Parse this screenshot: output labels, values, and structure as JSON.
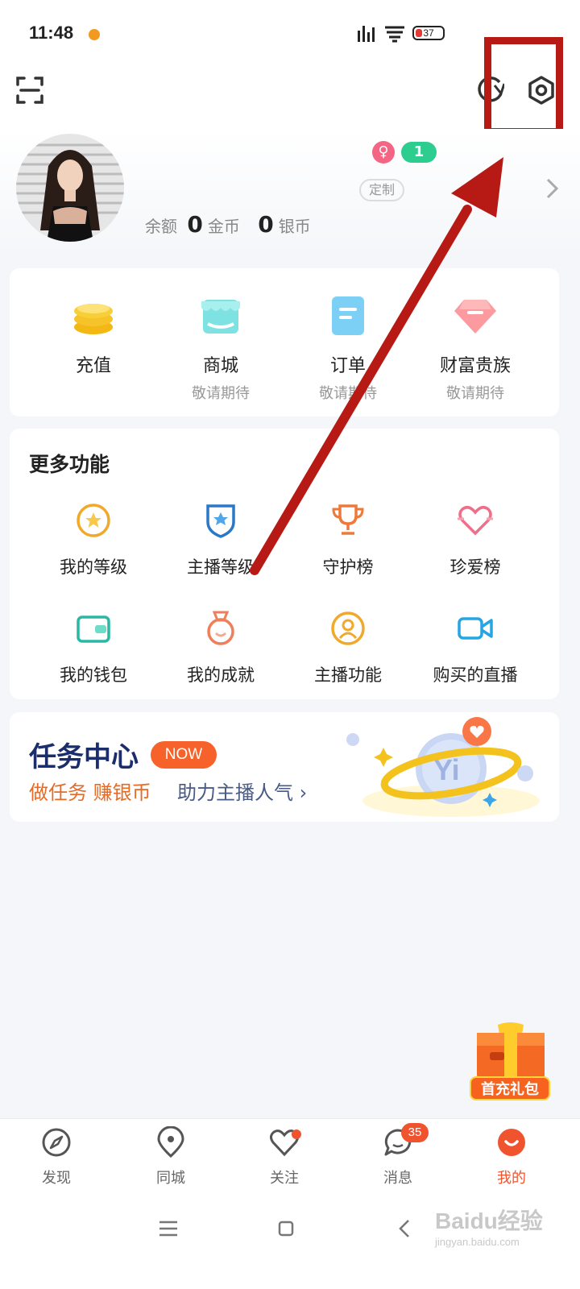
{
  "status_bar": {
    "time": "11:48",
    "battery": "37"
  },
  "header": {
    "icons": [
      "scan-icon",
      "switch-icon",
      "settings-icon"
    ]
  },
  "profile": {
    "level": "1",
    "gender_symbol": "♀",
    "tag": "定制",
    "balance_label": "余额",
    "gold_value": "0",
    "gold_unit": "金币",
    "silver_value": "0",
    "silver_unit": "银币"
  },
  "quick_actions": [
    {
      "label": "充值",
      "sub": "",
      "icon": "coins-icon"
    },
    {
      "label": "商城",
      "sub": "敬请期待",
      "icon": "shop-icon"
    },
    {
      "label": "订单",
      "sub": "敬请期待",
      "icon": "order-icon"
    },
    {
      "label": "财富贵族",
      "sub": "敬请期待",
      "icon": "diamond-icon"
    }
  ],
  "more_functions": {
    "title": "更多功能",
    "items": [
      {
        "label": "我的等级",
        "icon": "level-icon"
      },
      {
        "label": "主播等级",
        "icon": "anchor-level-icon"
      },
      {
        "label": "守护榜",
        "icon": "trophy-icon"
      },
      {
        "label": "珍爱榜",
        "icon": "heart-icon"
      },
      {
        "label": "我的钱包",
        "icon": "wallet-icon"
      },
      {
        "label": "我的成就",
        "icon": "medal-icon"
      },
      {
        "label": "主播功能",
        "icon": "anchor-user-icon"
      },
      {
        "label": "购买的直播",
        "icon": "video-icon"
      }
    ]
  },
  "task_center": {
    "title": "任务中心",
    "badge": "NOW",
    "sub_highlight": "做任务 赚银币",
    "sub_rest": "助力主播人气"
  },
  "gift": {
    "label": "首充礼包"
  },
  "bottom_nav": {
    "items": [
      {
        "label": "发现",
        "icon": "compass-icon",
        "active": false
      },
      {
        "label": "同城",
        "icon": "location-pin-icon",
        "active": false
      },
      {
        "label": "关注",
        "icon": "heart-outline-icon",
        "active": false
      },
      {
        "label": "消息",
        "icon": "chat-bubble-icon",
        "active": false
      },
      {
        "label": "我的",
        "icon": "profile-icon",
        "active": true
      }
    ],
    "message_badge": "35"
  },
  "watermark": {
    "text": "Baidu经验",
    "url": "jingyan.baidu.com"
  },
  "colors": {
    "accent": "#f0542f",
    "annotation": "#b71a14"
  }
}
